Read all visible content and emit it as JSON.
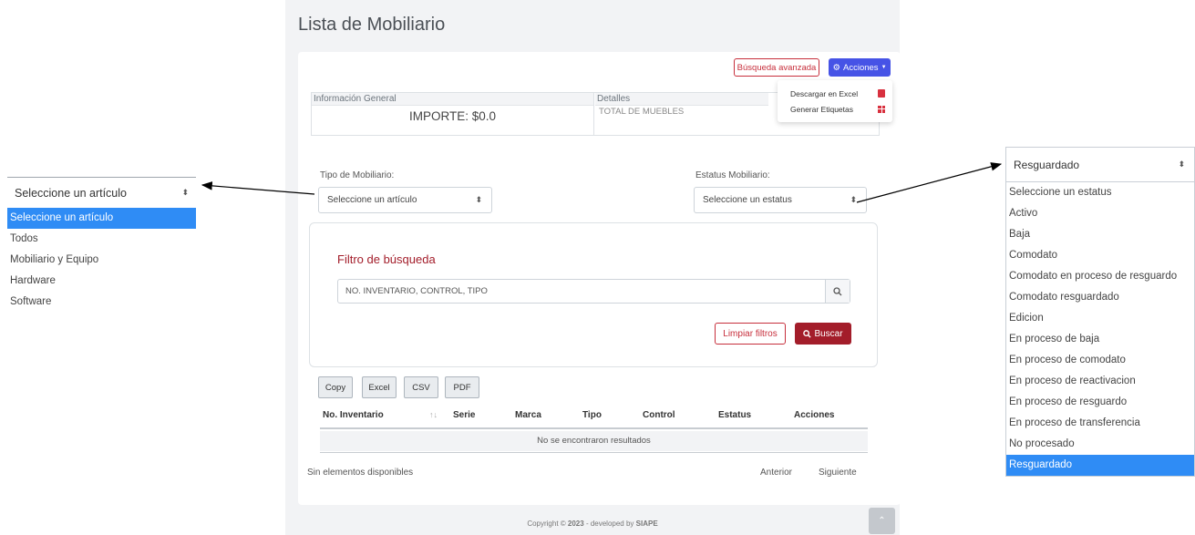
{
  "left_dropdown": {
    "selected": "Seleccione un artículo",
    "options": [
      "Seleccione un artículo",
      "Todos",
      "Mobiliario y Equipo",
      "Hardware",
      "Software"
    ],
    "active_index": 0
  },
  "right_dropdown": {
    "selected": "Resguardado",
    "options": [
      "Seleccione un estatus",
      "Activo",
      "Baja",
      "Comodato",
      "Comodato en proceso de resguardo",
      "Comodato resguardado",
      "Edicion",
      "En proceso de baja",
      "En proceso de comodato",
      "En proceso de reactivacion",
      "En proceso de resguardo",
      "En proceso de transferencia",
      "No procesado",
      "Resguardado"
    ],
    "active_index": 13
  },
  "page": {
    "title": "Lista de Mobiliario",
    "advanced_search": "Búsqueda avanzada",
    "actions": "Acciones",
    "actions_menu": {
      "excel": "Descargar en Excel",
      "labels": "Generar Etiquetas"
    },
    "info": {
      "general_header": "Información General",
      "importe": "IMPORTE: $0.0",
      "details_header": "Detalles",
      "total": "TOTAL DE MUEBLES"
    },
    "tipo_label": "Tipo de Mobiliario:",
    "tipo_value": "Seleccione un artículo",
    "estatus_label": "Estatus Mobiliario:",
    "estatus_value": "Seleccione un estatus",
    "filter": {
      "title": "Filtro de búsqueda",
      "placeholder": "NO. INVENTARIO, CONTROL, TIPO",
      "clear": "Limpiar filtros",
      "search": "Buscar"
    },
    "export_buttons": [
      "Copy",
      "Excel",
      "CSV",
      "PDF"
    ],
    "table": {
      "columns": [
        "No. Inventario",
        "Serie",
        "Marca",
        "Tipo",
        "Control",
        "Estatus",
        "Acciones"
      ],
      "empty": "No se encontraron resultados",
      "info": "Sin elementos disponibles",
      "prev": "Anterior",
      "next": "Siguiente"
    },
    "copyright_prefix": "Copyright ©",
    "year": "2023",
    "developed_by": "- developed by",
    "company": "SIAPE"
  },
  "colors": {
    "accent_red": "#a31d2a",
    "actions_blue": "#4653e6",
    "highlight_blue": "#2f8cf5"
  }
}
